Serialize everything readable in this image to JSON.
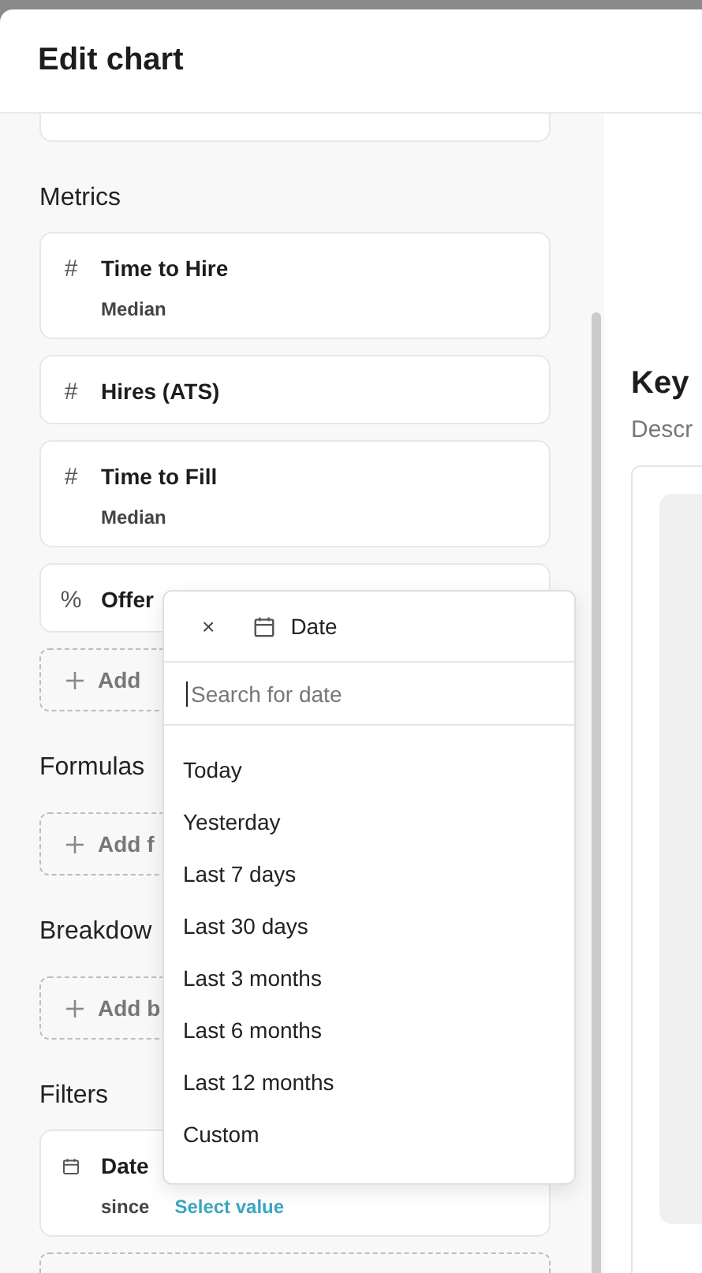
{
  "window": {
    "title": "Edit chart"
  },
  "sections": [
    {
      "title": "Metrics",
      "items": [
        {
          "kind": "metric",
          "icon": "#",
          "name": "Time to Hire",
          "sub": "Median"
        },
        {
          "kind": "metric",
          "icon": "#",
          "name": "Hires (ATS)"
        },
        {
          "kind": "metric",
          "icon": "#",
          "name": "Time to Fill",
          "sub": "Median"
        },
        {
          "kind": "metric",
          "icon": "%",
          "name": "Offer"
        }
      ],
      "add_label": "Add"
    },
    {
      "title": "Formulas",
      "add_label": "Add f"
    },
    {
      "title": "Breakdow",
      "add_label": "Add b"
    },
    {
      "title": "Filters",
      "items": [
        {
          "kind": "filter",
          "name": "Date",
          "operator": "since",
          "value": "Select value"
        }
      ],
      "add_button": true
    }
  ],
  "preview": {
    "title": "Key",
    "description": "Descr"
  },
  "dropdown": {
    "close": "×",
    "field_label": "Date",
    "search_placeholder": "Search for date",
    "options": [
      "Today",
      "Yesterday",
      "Last 7 days",
      "Last 30 days",
      "Last 3 months",
      "Last 6 months",
      "Last 12 months",
      "Custom"
    ]
  }
}
